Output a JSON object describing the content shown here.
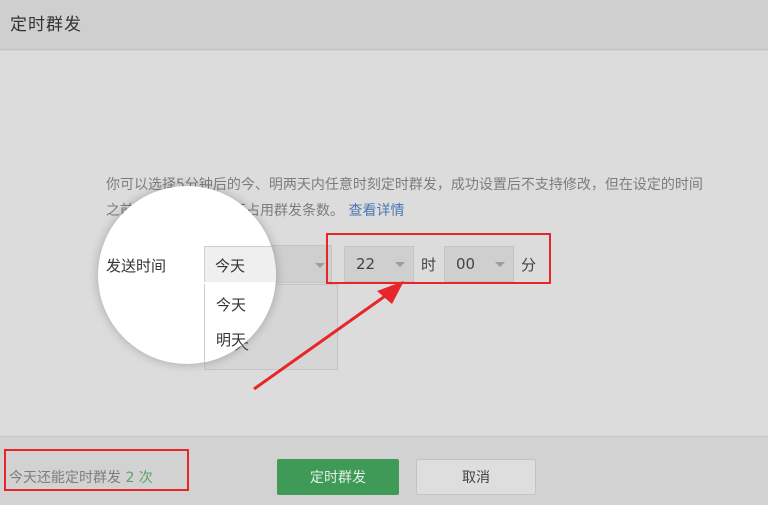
{
  "dialog": {
    "title": "定时群发"
  },
  "description": {
    "text": "你可以选择5分钟后的今、明两天内任意时刻定时群发，成功设置后不支持修改，但在设定的时间之前可取消，取消后不占用群发条数。",
    "link": "查看详情"
  },
  "send_time": {
    "label": "发送时间",
    "day_value": "今天",
    "day_options": [
      "今天",
      "明天"
    ],
    "hour_value": "22",
    "hour_unit": "时",
    "minute_value": "00",
    "minute_unit": "分"
  },
  "footer": {
    "quota_text": "今天还能定时群发",
    "quota_count": "2 次",
    "confirm_label": "定时群发",
    "cancel_label": "取消"
  },
  "colors": {
    "accent_green": "#3f9a58",
    "highlight_red": "#e8262a",
    "link_blue": "#4c77b0"
  }
}
